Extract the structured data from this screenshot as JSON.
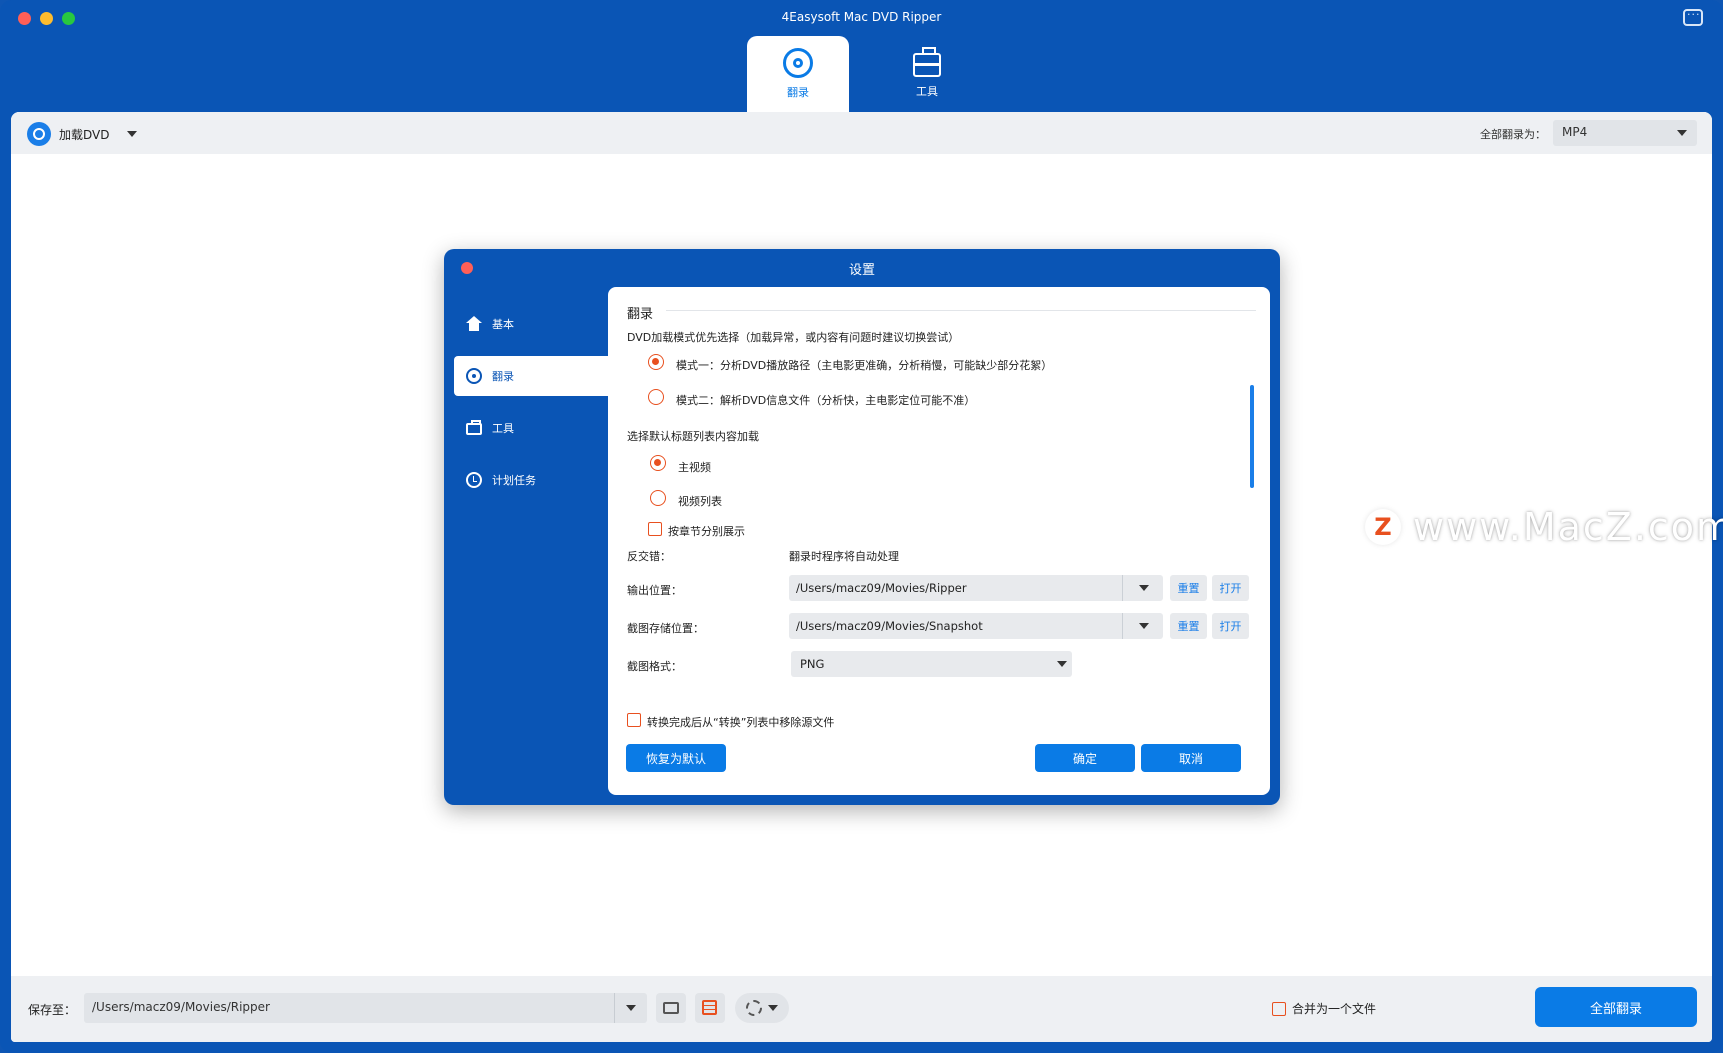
{
  "window": {
    "title": "4Easysoft Mac DVD Ripper",
    "tabs": [
      {
        "label": "翻录",
        "icon": "disc-icon"
      },
      {
        "label": "工具",
        "icon": "toolbox-icon"
      }
    ]
  },
  "toolbar": {
    "load_dvd": "加载DVD",
    "convert_all_label": "全部翻录为：",
    "convert_all_format": "MP4"
  },
  "bottom": {
    "save_label": "保存至：",
    "save_path": "/Users/macz09/Movies/Ripper",
    "merge_label": "合并为一个文件",
    "rip_all_button": "全部翻录"
  },
  "watermark": {
    "logo": "Z",
    "text": "www.MacZ.com"
  },
  "dialog": {
    "title": "设置",
    "nav": [
      {
        "label": "基本",
        "icon": "home-icon"
      },
      {
        "label": "翻录",
        "icon": "disc-icon"
      },
      {
        "label": "工具",
        "icon": "toolbox-icon"
      },
      {
        "label": "计划任务",
        "icon": "clock-icon"
      }
    ],
    "section_title": "翻录",
    "dvd_mode_heading": "DVD加载模式优先选择（加载异常，或内容有问题时建议切换尝试）",
    "mode1": "模式一：分析DVD播放路径（主电影更准确，分析稍慢，可能缺少部分花絮）",
    "mode2": "模式二：解析DVD信息文件（分析快，主电影定位可能不准）",
    "title_list_heading": "选择默认标题列表内容加载",
    "main_video": "主视频",
    "video_list": "视频列表",
    "chapter_split": "按章节分别展示",
    "deinterlace_label": "反交错：",
    "deinterlace_value": "翻录时程序将自动处理",
    "output_label": "输出位置：",
    "output_path": "/Users/macz09/Movies/Ripper",
    "snapshot_label": "截图存储位置：",
    "snapshot_path": "/Users/macz09/Movies/Snapshot",
    "snapshot_format_label": "截图格式：",
    "snapshot_format": "PNG",
    "reset": "重置",
    "open": "打开",
    "remove_source": "转换完成后从“转换”列表中移除源文件",
    "restore_default": "恢复为默认",
    "ok": "确定",
    "cancel": "取消"
  }
}
